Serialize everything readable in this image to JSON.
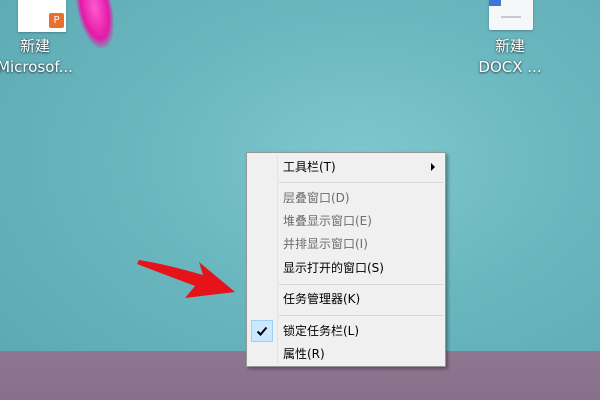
{
  "desktop": {
    "icons": [
      {
        "line1": "新建",
        "line2": "Microsof...",
        "icon": "powerpoint-file-icon",
        "badge": "P",
        "badge_color": "#e8702e"
      },
      {
        "line1": "新建",
        "line2": "DOCX ...",
        "icon": "word-docx-file-icon",
        "accent_color": "#3e77d6"
      }
    ],
    "background_color": "#69b6bf",
    "taskbar_color": "#8a738c"
  },
  "context_menu": {
    "items": [
      {
        "label": "工具栏(T)",
        "enabled": true,
        "has_submenu": true
      },
      {
        "label": "层叠窗口(D)",
        "enabled": false
      },
      {
        "label": "堆叠显示窗口(E)",
        "enabled": false
      },
      {
        "label": "并排显示窗口(I)",
        "enabled": false
      },
      {
        "label": "显示打开的窗口(S)",
        "enabled": true
      },
      {
        "label": "任务管理器(K)",
        "enabled": true
      },
      {
        "label": "锁定任务栏(L)",
        "enabled": true,
        "checked": true
      },
      {
        "label": "属性(R)",
        "enabled": true
      }
    ],
    "check_highlight_color": "#cce8ff"
  },
  "annotation": {
    "icon": "red-pointer-arrow-icon",
    "color": "#e5141b"
  }
}
